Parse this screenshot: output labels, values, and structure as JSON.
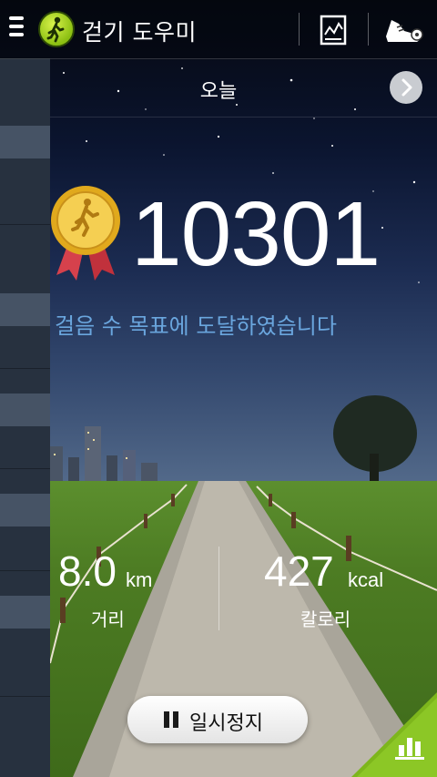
{
  "header": {
    "app_title": "걷기 도우미",
    "icons": [
      "menu-icon",
      "walker-logo-icon",
      "chart-report-icon",
      "shoe-icon"
    ]
  },
  "date_row": {
    "label": "오늘",
    "next_icon": "chevron-right-icon"
  },
  "summary": {
    "steps": "10301",
    "goal_message": "걸음 수 목표에 도달하였습니다",
    "medal_icon": "gold-medal-icon"
  },
  "stats": {
    "distance": {
      "value": "8.0",
      "unit": "km",
      "label": "거리"
    },
    "calories": {
      "value": "427",
      "unit": "kcal",
      "label": "칼로리"
    }
  },
  "controls": {
    "pause_label": "일시정지",
    "pause_icon": "pause-icon",
    "corner_icon": "bar-chart-icon"
  },
  "colors": {
    "goal_text": "#6aa6de",
    "accent_green": "#7db61c",
    "drawer": "#27313f"
  }
}
